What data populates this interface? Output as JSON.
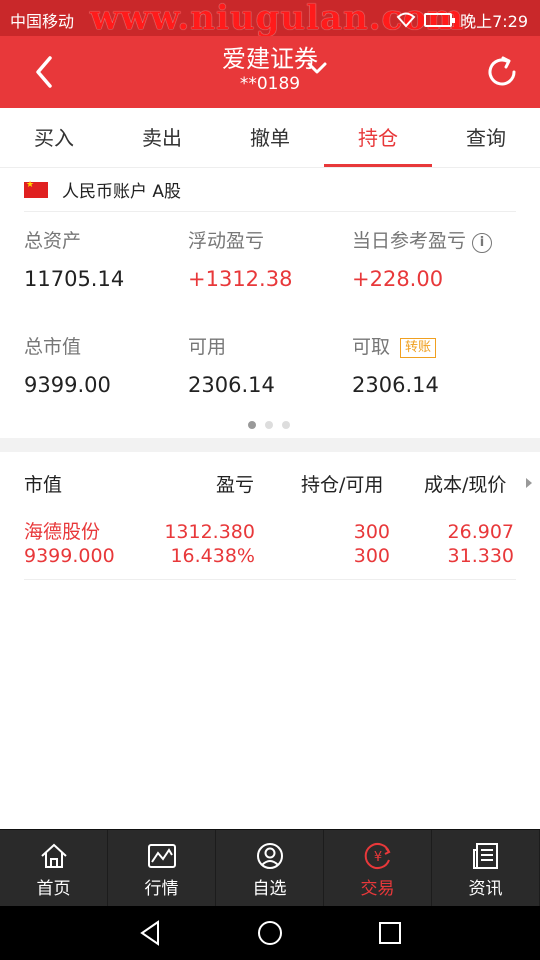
{
  "status_bar": {
    "carrier": "中国移动",
    "watermark": "www.niugulan.com",
    "time": "晚上7:29",
    "bar_color": "#c9282a"
  },
  "header": {
    "title": "爱建证券",
    "account_masked": "**0189",
    "bar_color": "#e8383a"
  },
  "tabs": [
    {
      "label": "买入"
    },
    {
      "label": "卖出"
    },
    {
      "label": "撤单"
    },
    {
      "label": "持仓"
    },
    {
      "label": "查询"
    }
  ],
  "active_tab": "持仓",
  "account": {
    "label": "人民币账户 A股",
    "flag_icon": "cn-flag-icon"
  },
  "summary": {
    "total_assets": {
      "label": "总资产",
      "value": "11705.14"
    },
    "floating_pl": {
      "label": "浮动盈亏",
      "value": "+1312.38"
    },
    "today_pl": {
      "label": "当日参考盈亏",
      "value": "+228.00"
    },
    "market_value": {
      "label": "总市值",
      "value": "9399.00"
    },
    "available": {
      "label": "可用",
      "value": "2306.14"
    },
    "withdrawable": {
      "label": "可取",
      "value": "2306.14",
      "badge": "转账"
    }
  },
  "pager": {
    "count": 3,
    "active": 1
  },
  "holdings": {
    "columns": [
      "市值",
      "盈亏",
      "持仓/可用",
      "成本/现价"
    ],
    "rows": [
      {
        "name": "海德股份",
        "market_value": "9399.000",
        "pl_amount": "1312.380",
        "pl_percent": "16.438%",
        "position": "300",
        "available": "300",
        "cost": "26.907",
        "price": "31.330"
      }
    ]
  },
  "bottom_nav": [
    {
      "label": "首页",
      "icon": "home-icon"
    },
    {
      "label": "行情",
      "icon": "market-chart-icon"
    },
    {
      "label": "自选",
      "icon": "user-icon"
    },
    {
      "label": "交易",
      "icon": "yuan-trade-icon"
    },
    {
      "label": "资讯",
      "icon": "news-icon"
    }
  ],
  "active_nav": "交易",
  "colors": {
    "accent_red": "#e8383a",
    "badge_orange": "#f0a020",
    "nav_bg": "#2a2a2a"
  }
}
